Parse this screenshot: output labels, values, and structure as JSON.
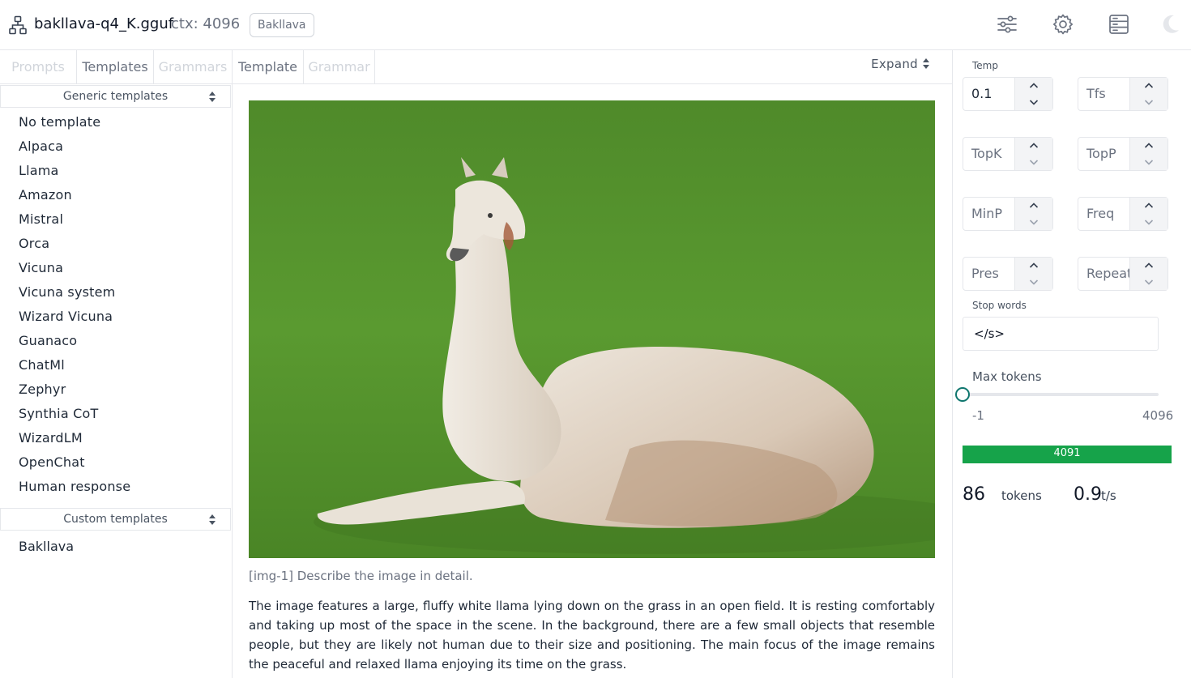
{
  "header": {
    "model": "bakllava-q4_K.gguf",
    "ctx_label": "ctx: 4096",
    "badge": "Bakllava",
    "icons": [
      "network-icon",
      "sliders-icon",
      "gear-icon",
      "server-icon",
      "moon-icon"
    ]
  },
  "left": {
    "tabs": [
      "Prompts",
      "Templates",
      "Grammars"
    ],
    "generic_group": "Generic templates",
    "templates": [
      "No template",
      "Alpaca",
      "Llama",
      "Amazon",
      "Mistral",
      "Orca",
      "Vicuna",
      "Vicuna system",
      "Wizard Vicuna",
      "Guanaco",
      "ChatMl",
      "Zephyr",
      "Synthia CoT",
      "WizardLM",
      "OpenChat",
      "Human response"
    ],
    "custom_group": "Custom templates",
    "custom_templates": [
      "Bakllava"
    ]
  },
  "mid": {
    "tabs": [
      "Template",
      "Grammar"
    ],
    "expand": "Expand",
    "prompt": "[img-1] Describe the image in detail.",
    "answer": "The image features a large, fluffy white llama lying down on the grass in an open field. It is resting comfortably and taking up most of the space in the scene. In the background, there are a few small objects that resemble people, but they are likely not human due to their size and positioning. The main focus of the image remains the peaceful and relaxed llama enjoying its time on the grass."
  },
  "params": {
    "temp_label": "Temp",
    "temp_value": "0.1",
    "tfs": "Tfs",
    "topk": "TopK",
    "topp": "TopP",
    "minp": "MinP",
    "freq": "Freq",
    "pres": "Pres",
    "repeat": "Repeat",
    "stop_label": "Stop words",
    "stop_value": "</s>",
    "max_label": "Max tokens",
    "max_min": "-1",
    "max_max": "4096",
    "max_value": -1
  },
  "stats": {
    "ctx_remaining": "4091",
    "ctx_fill_fraction": 0.0012,
    "tokens": "86",
    "tokens_unit": "tokens",
    "speed": "0.9",
    "speed_unit": "t/s"
  },
  "colors": {
    "accent": "#16a34a",
    "slider": "#0f766e"
  }
}
